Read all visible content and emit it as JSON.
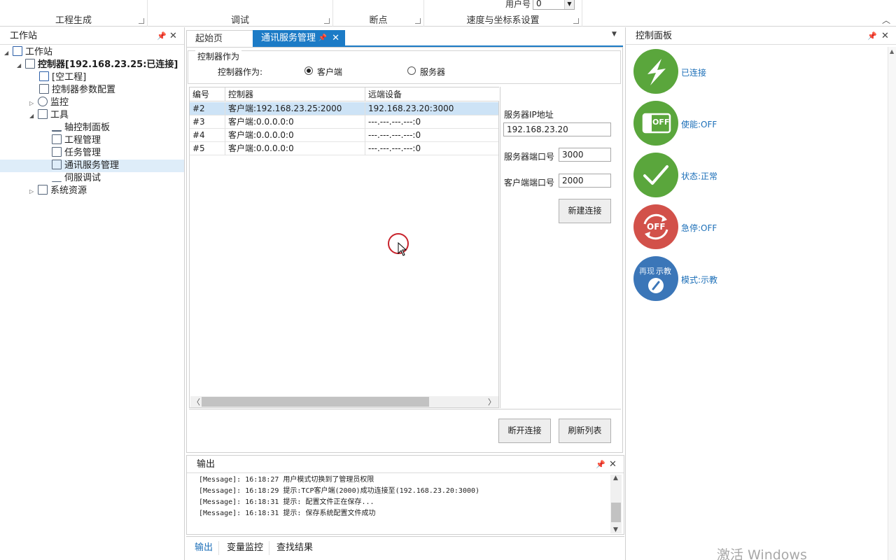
{
  "ribbon": {
    "groups": [
      "工程生成",
      "调试",
      "断点",
      "速度与坐标系设置"
    ],
    "user_no_label": "用户号",
    "user_no_value": "0"
  },
  "left_panel": {
    "title": "工作站",
    "tree": {
      "root": "工作站",
      "controller": "控制器[192.168.23.25:已连接]",
      "empty_project": "[空工程]",
      "param_config": "控制器参数配置",
      "monitor": "监控",
      "tools": "工具",
      "axis_panel": "轴控制面板",
      "project_mgmt": "工程管理",
      "task_mgmt": "任务管理",
      "comm_service": "通讯服务管理",
      "servo_debug": "伺服调试",
      "sys_resources": "系统资源"
    }
  },
  "doc_tabs": {
    "home": "起始页",
    "comm": "通讯服务管理"
  },
  "role": {
    "group_title": "控制器作为",
    "label": "控制器作为:",
    "client": "客户端",
    "server": "服务器",
    "selected": "客户端"
  },
  "grid": {
    "headers": [
      "编号",
      "控制器",
      "远端设备"
    ],
    "rows": [
      [
        "#2",
        "客户端:192.168.23.25:2000",
        "192.168.23.20:3000"
      ],
      [
        "#3",
        "客户端:0.0.0.0:0",
        "---.---.---.---:0"
      ],
      [
        "#4",
        "客户端:0.0.0.0:0",
        "---.---.---.---:0"
      ],
      [
        "#5",
        "客户端:0.0.0.0:0",
        "---.---.---.---:0"
      ]
    ],
    "selected_row": 0
  },
  "config": {
    "server_ip_label": "服务器IP地址",
    "server_ip": "192.168.23.20",
    "server_port_label": "服务器端口号",
    "server_port": "3000",
    "client_port_label": "客户端端口号",
    "client_port": "2000",
    "new_conn": "新建连接"
  },
  "actions": {
    "disconnect": "断开连接",
    "refresh": "刷新列表"
  },
  "output": {
    "title": "输出",
    "lines": [
      "[Message]: 16:18:27 用户模式切换到了管理员权限",
      "[Message]: 16:18:29 提示:TCP客户端(2000)成功连接至(192.168.23.20:3000)",
      "[Message]: 16:18:31 提示: 配置文件正在保存...",
      "[Message]: 16:18:31 提示: 保存系统配置文件成功"
    ],
    "tabs": [
      "输出",
      "变量监控",
      "查找结果"
    ]
  },
  "control_panel": {
    "title": "控制面板",
    "items": [
      {
        "label": "已连接",
        "color": "#5aa63c"
      },
      {
        "label": "使能:OFF",
        "color": "#5aa63c",
        "badge": "OFF"
      },
      {
        "label": "状态:正常",
        "color": "#5aa63c"
      },
      {
        "label": "急停:OFF",
        "color": "#d2514a",
        "badge": "OFF"
      },
      {
        "label": "模式:示教",
        "color": "#3b76b8",
        "badge_left": "再现",
        "badge_right": "示教"
      }
    ]
  },
  "watermark": "激活 Windows",
  "colors": {
    "accent": "#1c7bc6",
    "selection": "#cde3f6",
    "green": "#5aa63c",
    "red": "#d2514a",
    "blue": "#3b76b8"
  }
}
